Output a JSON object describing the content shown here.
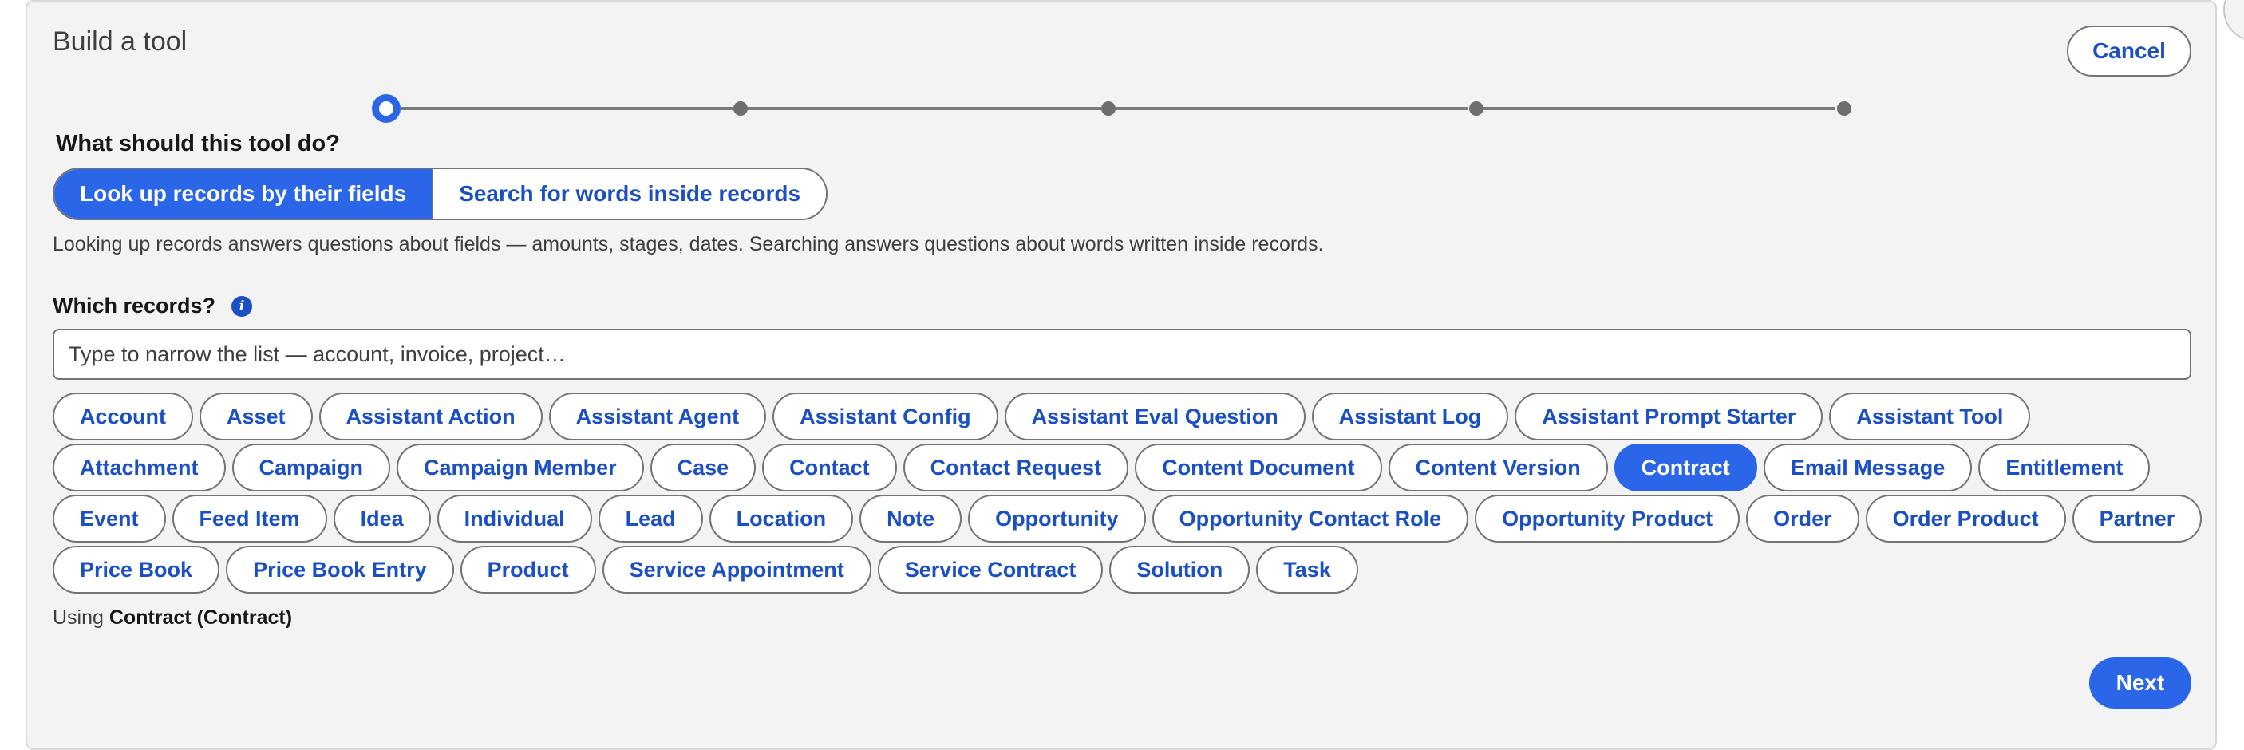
{
  "header": {
    "title": "Build a tool",
    "cancel_label": "Cancel"
  },
  "stepper": {
    "total_steps": 5,
    "current_step": 1
  },
  "question": "What should this tool do?",
  "modes": [
    {
      "label": "Look up records by their fields",
      "selected": true
    },
    {
      "label": "Search for words inside records",
      "selected": false
    }
  ],
  "help_text": "Looking up records answers questions about fields — amounts, stages, dates. Searching answers questions about words written inside records.",
  "records": {
    "label": "Which records?",
    "info_icon": "i",
    "search_placeholder": "Type to narrow the list — account, invoice, project…",
    "items": [
      "Account",
      "Asset",
      "Assistant Action",
      "Assistant Agent",
      "Assistant Config",
      "Assistant Eval Question",
      "Assistant Log",
      "Assistant Prompt Starter",
      "Assistant Tool",
      "Attachment",
      "Campaign",
      "Campaign Member",
      "Case",
      "Contact",
      "Contact Request",
      "Content Document",
      "Content Version",
      "Contract",
      "Email Message",
      "Entitlement",
      "Event",
      "Feed Item",
      "Idea",
      "Individual",
      "Lead",
      "Location",
      "Note",
      "Opportunity",
      "Opportunity Contact Role",
      "Opportunity Product",
      "Order",
      "Order Product",
      "Partner",
      "Price Book",
      "Price Book Entry",
      "Product",
      "Service Appointment",
      "Service Contract",
      "Solution",
      "Task"
    ],
    "selected": "Contract"
  },
  "using": {
    "prefix": "Using",
    "value": "Contract (Contract)"
  },
  "footer": {
    "next_label": "Next"
  },
  "colors": {
    "accent": "#2b66e8",
    "link": "#1b4fc4",
    "panel_bg": "#f3f3f3"
  }
}
